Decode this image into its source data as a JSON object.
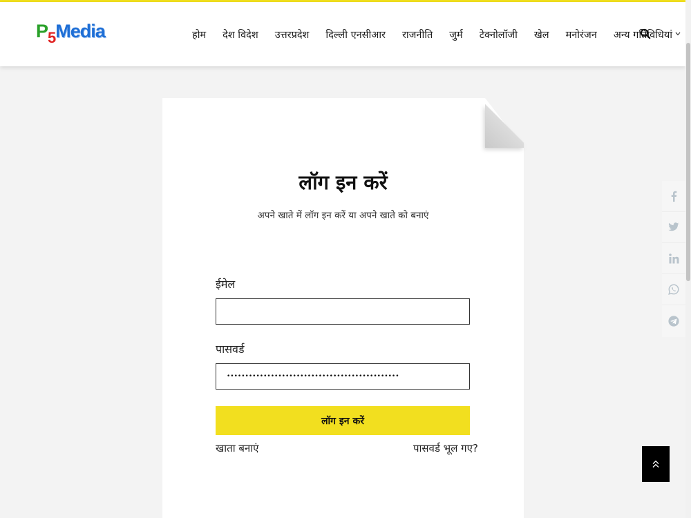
{
  "brand": {
    "letter_p": "P",
    "digit": "5",
    "word": "Media"
  },
  "nav": {
    "items": [
      {
        "label": "होम"
      },
      {
        "label": "देश विदेश"
      },
      {
        "label": "उत्तरप्रदेश"
      },
      {
        "label": "दिल्ली एनसीआर"
      },
      {
        "label": "राजनीति"
      },
      {
        "label": "जुर्म"
      },
      {
        "label": "टेक्नोलॉजी"
      },
      {
        "label": "खेल"
      },
      {
        "label": "मनोरंजन"
      },
      {
        "label": "अन्य गतिविधियां"
      }
    ],
    "more_icon": "chevron-down-icon",
    "search_icon": "search-icon"
  },
  "login": {
    "title": "लॉग इन करें",
    "subtitle": "अपने खाते में लॉग इन करें या अपने खाते को बनाएं",
    "email_label": "ईमेल",
    "email_value": "",
    "password_label": "पासवर्ड",
    "password_mask": "••••••••••••••••••••••••••••••••••••••••••••••••••••••••••••••••",
    "submit_label": "लॉग इन करें",
    "create_account": "खाता बनाएं",
    "forgot_password": "पासवर्ड भूल गए?"
  },
  "social": [
    "facebook-icon",
    "twitter-icon",
    "linkedin-icon",
    "whatsapp-icon",
    "telegram-icon"
  ],
  "colors": {
    "accent": "#f2df1f",
    "topline": "#f2e01e",
    "social_icon": "#b9c4cc"
  }
}
